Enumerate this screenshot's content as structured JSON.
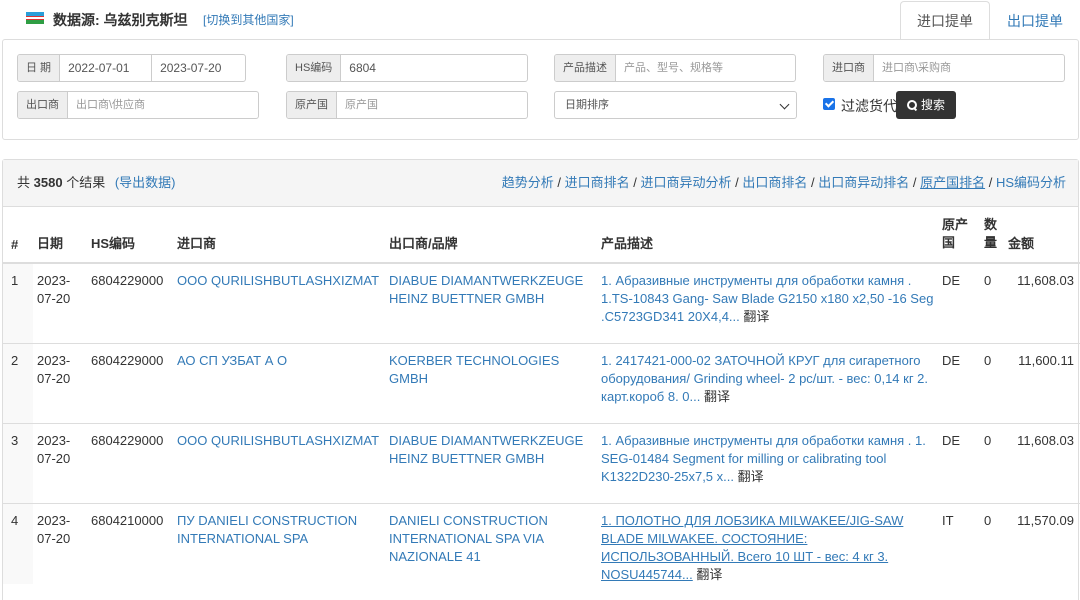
{
  "header": {
    "source_label": "数据源:  乌兹别克斯坦",
    "switch_link": "[切换到其他国家]",
    "tabs": [
      {
        "label": "进口提单",
        "active": true
      },
      {
        "label": "出口提单",
        "active": false
      }
    ]
  },
  "filters": {
    "date_label": "日 期",
    "date_from": "2022-07-01",
    "date_to": "2023-07-20",
    "hs_label": "HS编码",
    "hs_value": "6804",
    "product_label": "产品描述",
    "product_placeholder": "产品、型号、规格等",
    "importer_label": "进口商",
    "importer_placeholder": "进口商\\采购商",
    "exporter_label": "出口商",
    "exporter_placeholder": "出口商\\供应商",
    "origin_label": "原产国",
    "origin_placeholder": "原产国",
    "sort_selected": "日期排序",
    "filter_goods_label": "过滤货代",
    "filter_goods_checked": true,
    "search_button": "搜索"
  },
  "results": {
    "count_prefix": "共",
    "count": "3580",
    "count_suffix": "个结果",
    "export_link": "(导出数据)",
    "analysis_links": [
      "趋势分析",
      "进口商排名",
      "进口商异动分析",
      "出口商排名",
      "出口商异动排名",
      "原产国排名",
      "HS编码分析"
    ],
    "columns": {
      "num": "#",
      "date": "日期",
      "hs": "HS编码",
      "importer": "进口商",
      "exporter": "出口商/品牌",
      "desc": "产品描述",
      "origin": "原产国",
      "qty": "数量",
      "amount": "金额"
    },
    "translate_label": "翻译",
    "rows": [
      {
        "num": "1",
        "date": "2023-07-20",
        "hs": "6804229000",
        "importer": "OOO QURILISHBUTLASHXIZMAT",
        "exporter": "DIABUE DIAMANTWERKZEUGE HEINZ BUETTNER GMBH",
        "desc": "1. Абразивные инструменты для обработки камня . 1.TS-10843 Gang- Saw Blade G2150 x180 x2,50 -16 Seg .C5723GD341 20X4,4...",
        "origin": "DE",
        "qty": "0",
        "amount": "11,608.03"
      },
      {
        "num": "2",
        "date": "2023-07-20",
        "hs": "6804229000",
        "importer": "АО СП УЗБАТ А О",
        "exporter": "KOERBER TECHNOLOGIES GMBH",
        "desc": "1. 2417421-000-02 ЗАТОЧНОЙ КРУГ для сигаретного оборудования/ Grinding wheel- 2 рс/шт. - вес: 0,14 кг 2. карт.короб 8. 0...",
        "origin": "DE",
        "qty": "0",
        "amount": "11,600.11"
      },
      {
        "num": "3",
        "date": "2023-07-20",
        "hs": "6804229000",
        "importer": "OOO QURILISHBUTLASHXIZMAT",
        "exporter": "DIABUE DIAMANTWERKZEUGE HEINZ BUETTNER GMBH",
        "desc": "1. Абразивные инструменты для обработки камня . 1. SEG-01484 Segment for milling or calibrating tool K1322D230-25x7,5 x...",
        "origin": "DE",
        "qty": "0",
        "amount": "11,608.03"
      },
      {
        "num": "4",
        "date": "2023-07-20",
        "hs": "6804210000",
        "importer": "ПУ DANIELI CONSTRUCTION INTERNATIONAL SPA",
        "exporter": "DANIELI CONSTRUCTION INTERNATIONAL SPA VIA NAZIONALE 41",
        "desc": "1. ПОЛОТНО ДЛЯ ЛОБЗИКА MILWAKEE/JIG-SAW BLADE MILWAKEE. СОСТОЯНИЕ: ИСПОЛЬЗОВАННЫЙ. Всего 10 ШТ - вес: 4 кг 3. NOSU445744...",
        "origin": "IT",
        "qty": "0",
        "amount": "11,570.09"
      }
    ]
  }
}
